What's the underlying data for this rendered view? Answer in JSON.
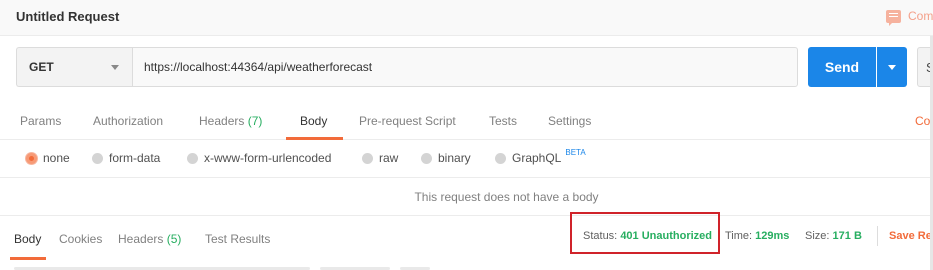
{
  "title_bar": {
    "title": "Untitled Request",
    "comments_label": "Com"
  },
  "request": {
    "method": "GET",
    "url": "https://localhost:44364/api/weatherforecast",
    "send_label": "Send",
    "save_label": "S"
  },
  "request_tabs": [
    {
      "label": "Params",
      "count": ""
    },
    {
      "label": "Authorization",
      "count": ""
    },
    {
      "label": "Headers",
      "count": "(7)"
    },
    {
      "label": "Body",
      "count": ""
    },
    {
      "label": "Pre-request Script",
      "count": ""
    },
    {
      "label": "Tests",
      "count": ""
    },
    {
      "label": "Settings",
      "count": ""
    }
  ],
  "active_request_tab": "Body",
  "cookies_link": "Coo",
  "body_types": [
    {
      "label": "none",
      "selected": true
    },
    {
      "label": "form-data",
      "selected": false
    },
    {
      "label": "x-www-form-urlencoded",
      "selected": false
    },
    {
      "label": "raw",
      "selected": false
    },
    {
      "label": "binary",
      "selected": false
    },
    {
      "label": "GraphQL",
      "selected": false,
      "badge": "BETA"
    }
  ],
  "no_body_message": "This request does not have a body",
  "response_tabs": [
    {
      "label": "Body",
      "count": ""
    },
    {
      "label": "Cookies",
      "count": ""
    },
    {
      "label": "Headers",
      "count": "(5)"
    },
    {
      "label": "Test Results",
      "count": ""
    }
  ],
  "active_response_tab": "Body",
  "response_meta": {
    "status_label": "Status:",
    "status_value": "401 Unauthorized",
    "time_label": "Time:",
    "time_value": "129ms",
    "size_label": "Size:",
    "size_value": "171 B",
    "save_response_label": "Save Re"
  },
  "colors": {
    "accent": "#f26b3a",
    "primary": "#1b86e8",
    "success": "#27ae60",
    "highlight_box": "#d0232a"
  },
  "icons": [
    "comment-icon",
    "chevron-down-icon",
    "radio-icon"
  ]
}
